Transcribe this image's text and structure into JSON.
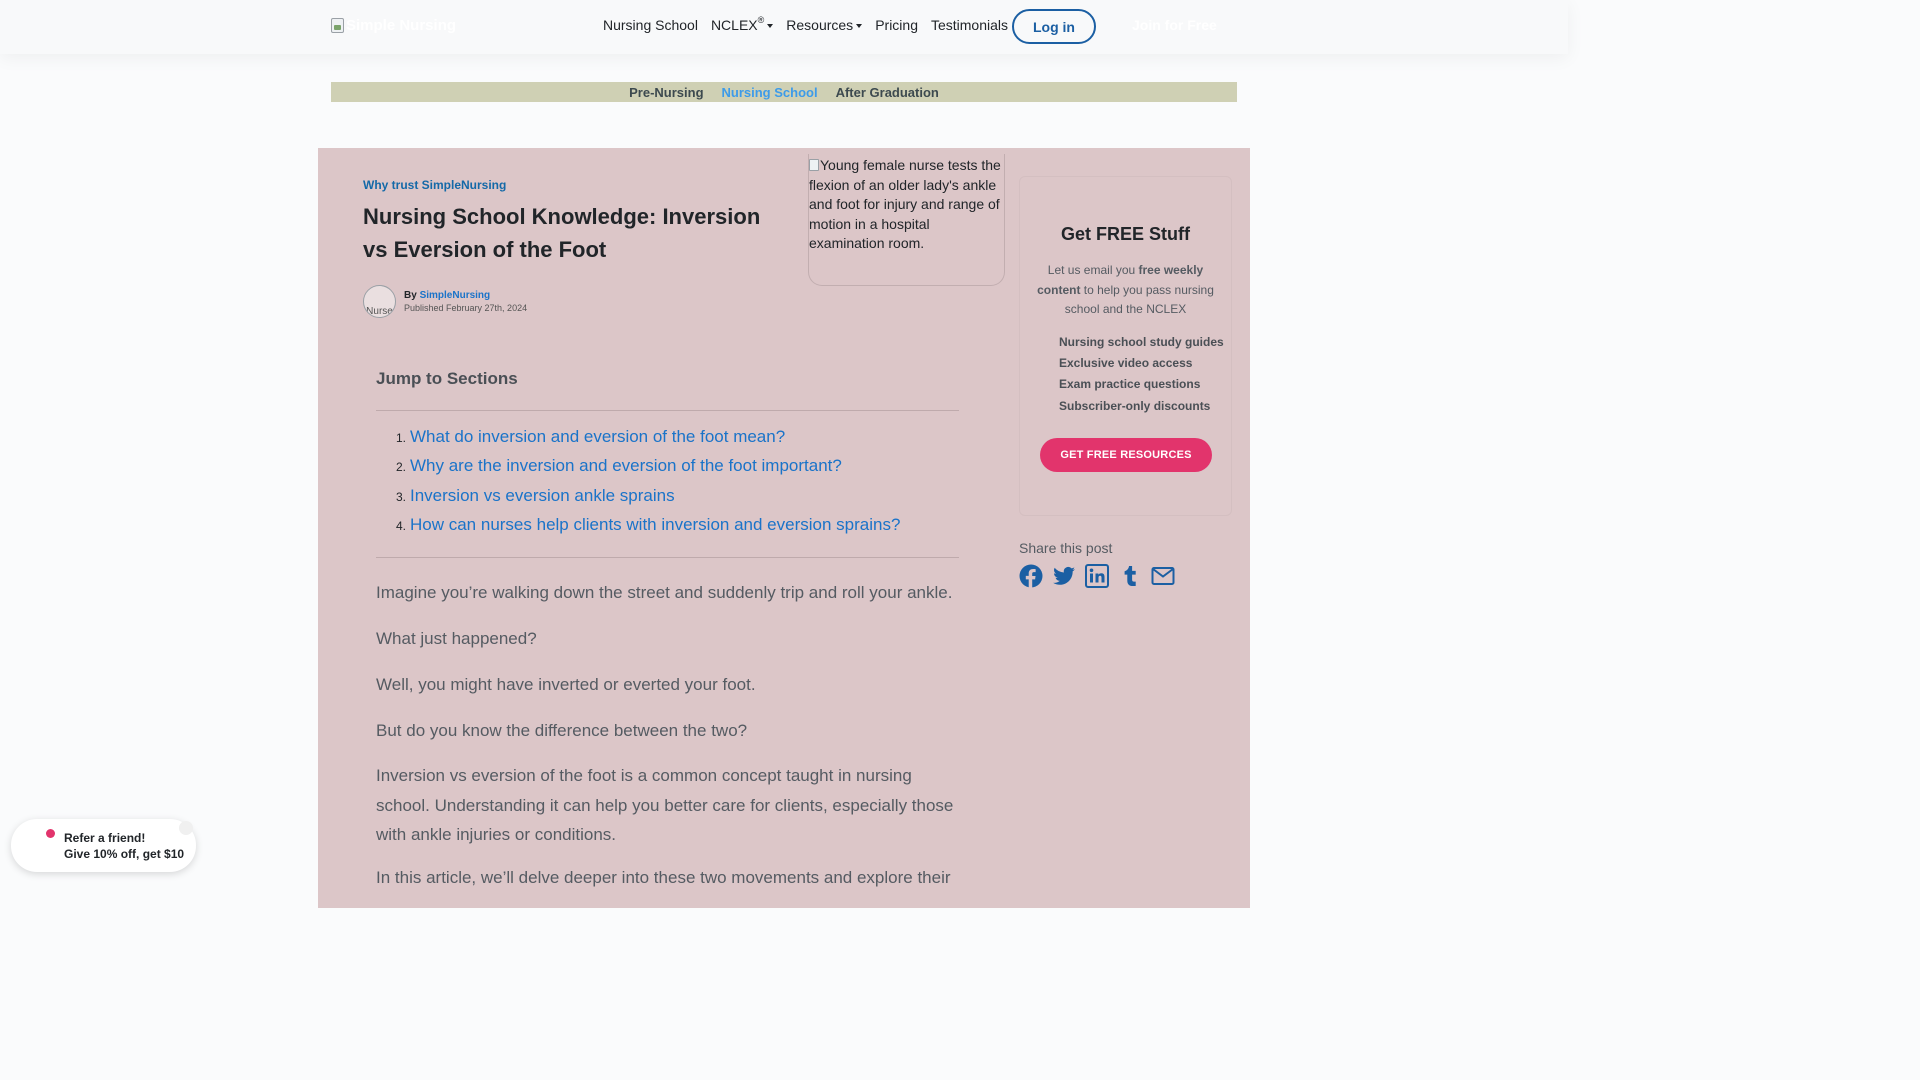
{
  "header": {
    "logo_alt": "Simple Nursing",
    "nav": [
      {
        "label": "Nursing School"
      },
      {
        "label": "NCLEX",
        "sup": "®",
        "dropdown": true
      },
      {
        "label": "Resources",
        "dropdown": true
      },
      {
        "label": "Pricing"
      },
      {
        "label": "Testimonials"
      }
    ],
    "login_label": "Log in",
    "join_label": "Join for Free"
  },
  "categories": {
    "items": [
      "Pre-Nursing",
      "Nursing School",
      "After Graduation"
    ],
    "active": "Nursing School"
  },
  "article": {
    "trust_link": "Why trust SimpleNursing",
    "title": "Nursing School Knowledge: Inversion vs Eversion of the Foot",
    "author_avatar_alt": "Nurse",
    "by_prefix": "By",
    "author_name": "SimpleNursing",
    "published": "Published February 27th, 2024",
    "hero_alt": "Young female nurse tests the flexion of an older lady's ankle and foot for injury and range of motion in a hospital examination room."
  },
  "toc": {
    "title": "Jump to Sections",
    "items": [
      {
        "num": "1.",
        "label": "What do inversion and eversion of the foot mean?"
      },
      {
        "num": "2.",
        "label": "Why are the inversion and eversion of the foot important?"
      },
      {
        "num": "3.",
        "label": "Inversion vs eversion ankle sprains"
      },
      {
        "num": "4.",
        "label": "How can nurses help clients with inversion and eversion sprains?"
      }
    ]
  },
  "body": {
    "p1": "Imagine you’re walking down the street and suddenly trip and roll your ankle.",
    "p2": "What just happened?",
    "p3": "Well, you might have inverted or everted your foot.",
    "p4": "But do you know the difference between the two?",
    "p5": "Inversion vs eversion of the foot is a common concept taught in nursing school. Understanding it can help you better care for clients, especially those with ankle injuries or conditions.",
    "p6": "In this article, we’ll delve deeper into these two movements and explore their"
  },
  "sidebar": {
    "free_title": "Get FREE Stuff",
    "desc_pre": "Let us email you ",
    "desc_bold": "free weekly content",
    "desc_post": " to help you pass nursing school and the NCLEX",
    "benefits": [
      "Nursing school study guides",
      "Exclusive video access",
      "Exam practice questions",
      "Subscriber-only discounts"
    ],
    "cta_label": "GET FREE RESOURCES",
    "share_label": "Share this post",
    "share_icons": [
      "facebook-icon",
      "twitter-icon",
      "linkedin-icon",
      "tumblr-icon",
      "email-icon"
    ]
  },
  "referral": {
    "line1": "Refer a friend!",
    "line2": "Give 10% off, get $10"
  },
  "colors": {
    "brand_blue": "#1b5fa3",
    "link_blue": "#1a73c9",
    "active_category": "#3d9be9",
    "cta_pink": "#e2346c",
    "panel_bg": "#dcc6c8",
    "category_bar": "#cfd0b4"
  }
}
